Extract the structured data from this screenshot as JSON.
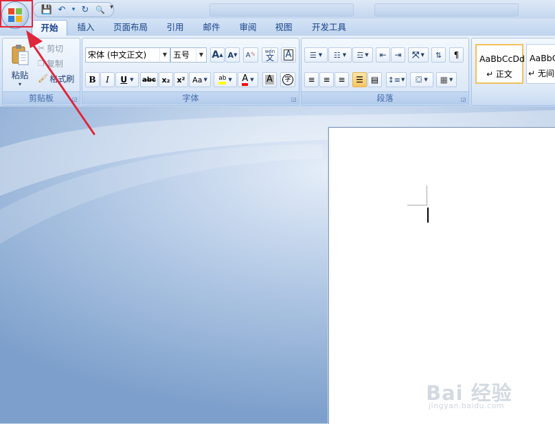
{
  "quick_access": {
    "items": [
      {
        "name": "save",
        "glyph": "💾"
      },
      {
        "name": "undo",
        "glyph": "↶"
      },
      {
        "name": "undo-dropdown",
        "glyph": "▾"
      },
      {
        "name": "redo",
        "glyph": "↻"
      },
      {
        "name": "print-preview",
        "glyph": "🔍"
      }
    ],
    "customize_glyph": "▾"
  },
  "tabs": [
    {
      "label": "开始",
      "active": true
    },
    {
      "label": "插入"
    },
    {
      "label": "页面布局"
    },
    {
      "label": "引用"
    },
    {
      "label": "邮件"
    },
    {
      "label": "审阅"
    },
    {
      "label": "视图"
    },
    {
      "label": "开发工具"
    }
  ],
  "clipboard": {
    "label": "剪贴板",
    "paste": "粘贴",
    "cut": "剪切",
    "copy": "复制",
    "format_painter": "格式刷"
  },
  "font": {
    "label": "字体",
    "font_name": "宋体 (中文正文)",
    "font_size": "五号",
    "grow_font": "A",
    "shrink_font": "A",
    "clear_format": "A",
    "phonetic": "wén",
    "phonetic_char": "文",
    "char_border": "A",
    "bold": "B",
    "italic": "I",
    "underline": "U",
    "strikethrough": "abc",
    "subscript": "x₂",
    "superscript": "x²",
    "change_case": "Aa",
    "highlight": "ab",
    "font_color": "A",
    "char_shading": "A",
    "enclose_char": "字",
    "highlight_color": "#ffff00",
    "font_color_value": "#ff0000"
  },
  "paragraph": {
    "label": "段落"
  },
  "styles": {
    "items": [
      {
        "sample": "AaBbCcDd",
        "name": "↵ 正文",
        "selected": true
      },
      {
        "sample": "AaBbCc",
        "name": "↵ 无间",
        "selected": false
      }
    ]
  },
  "watermark": {
    "logo": "Bai 经验",
    "url": "jingyan.baidu.com"
  },
  "colors": {
    "accent": "#15428b",
    "annotation": "#e0263a"
  }
}
